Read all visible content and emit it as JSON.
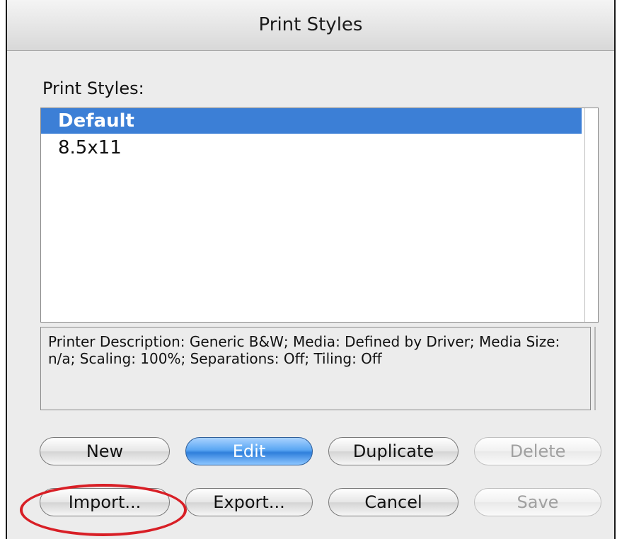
{
  "window": {
    "title": "Print Styles"
  },
  "styles_list": {
    "label": "Print Styles:",
    "items": [
      {
        "label": "Default",
        "selected": true
      },
      {
        "label": "8.5x11",
        "selected": false
      }
    ]
  },
  "description": {
    "text": "Printer Description: Generic B&W;  Media: Defined by Driver;  Media Size: n/a;  Scaling: 100%;  Separations: Off;  Tiling: Off"
  },
  "buttons": {
    "new": "New",
    "edit": "Edit",
    "duplicate": "Duplicate",
    "delete": "Delete",
    "import": "Import...",
    "export": "Export...",
    "cancel": "Cancel",
    "save": "Save"
  },
  "colors": {
    "selection": "#3c7fd6",
    "default_button": "#2f7fdc",
    "annotation_ring": "#d81f26"
  }
}
